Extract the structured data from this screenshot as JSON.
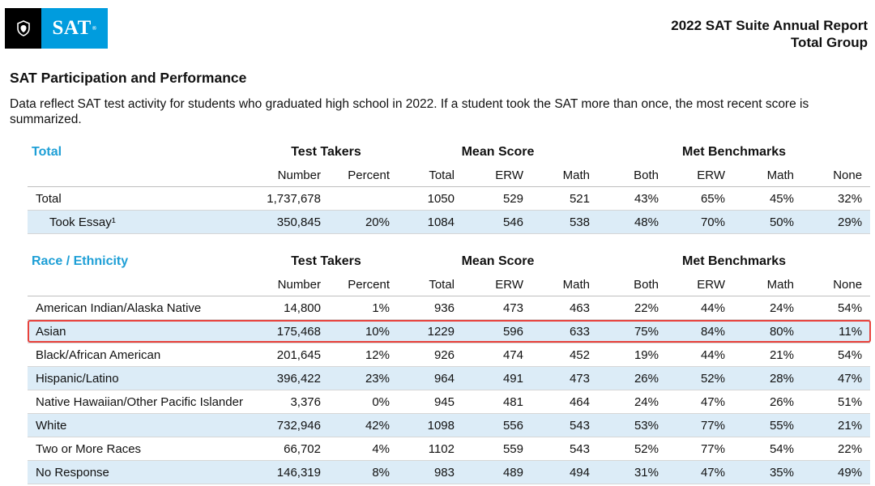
{
  "header": {
    "logo_text": "SAT",
    "logo_mark": "®",
    "report_title_line1": "2022 SAT Suite Annual Report",
    "report_title_line2": "Total Group"
  },
  "section_title": "SAT Participation and Performance",
  "description": "Data reflect SAT test activity for students who graduated high school in 2022. If a student took the SAT more than once, the most recent score is summarized.",
  "group_headers": {
    "test_takers": "Test Takers",
    "mean_score": "Mean Score",
    "met_benchmarks": "Met Benchmarks"
  },
  "columns": [
    "Number",
    "Percent",
    "Total",
    "ERW",
    "Math",
    "Both",
    "ERW",
    "Math",
    "None"
  ],
  "total_section": {
    "title": "Total",
    "rows": [
      {
        "label": "Total",
        "cells": [
          "1,737,678",
          "",
          "1050",
          "529",
          "521",
          "43%",
          "65%",
          "45%",
          "32%"
        ]
      },
      {
        "label": "Took Essay¹",
        "cells": [
          "350,845",
          "20%",
          "1084",
          "546",
          "538",
          "48%",
          "70%",
          "50%",
          "29%"
        ]
      }
    ]
  },
  "race_section": {
    "title": "Race / Ethnicity",
    "rows": [
      {
        "label": "American Indian/Alaska Native",
        "cells": [
          "14,800",
          "1%",
          "936",
          "473",
          "463",
          "22%",
          "44%",
          "24%",
          "54%"
        ]
      },
      {
        "label": "Asian",
        "cells": [
          "175,468",
          "10%",
          "1229",
          "596",
          "633",
          "75%",
          "84%",
          "80%",
          "11%"
        ]
      },
      {
        "label": "Black/African American",
        "cells": [
          "201,645",
          "12%",
          "926",
          "474",
          "452",
          "19%",
          "44%",
          "21%",
          "54%"
        ]
      },
      {
        "label": "Hispanic/Latino",
        "cells": [
          "396,422",
          "23%",
          "964",
          "491",
          "473",
          "26%",
          "52%",
          "28%",
          "47%"
        ]
      },
      {
        "label": "Native Hawaiian/Other Pacific Islander",
        "cells": [
          "3,376",
          "0%",
          "945",
          "481",
          "464",
          "24%",
          "47%",
          "26%",
          "51%"
        ]
      },
      {
        "label": "White",
        "cells": [
          "732,946",
          "42%",
          "1098",
          "556",
          "543",
          "53%",
          "77%",
          "55%",
          "21%"
        ]
      },
      {
        "label": "Two or More Races",
        "cells": [
          "66,702",
          "4%",
          "1102",
          "559",
          "543",
          "52%",
          "77%",
          "54%",
          "22%"
        ]
      },
      {
        "label": "No Response",
        "cells": [
          "146,319",
          "8%",
          "983",
          "489",
          "494",
          "31%",
          "47%",
          "35%",
          "49%"
        ]
      }
    ]
  },
  "highlighted_row": "Asian",
  "colors": {
    "accent": "#1e9fd6",
    "logo_blue": "#009cde",
    "row_shade": "#dcecf7",
    "highlight_border": "#e8423c"
  }
}
